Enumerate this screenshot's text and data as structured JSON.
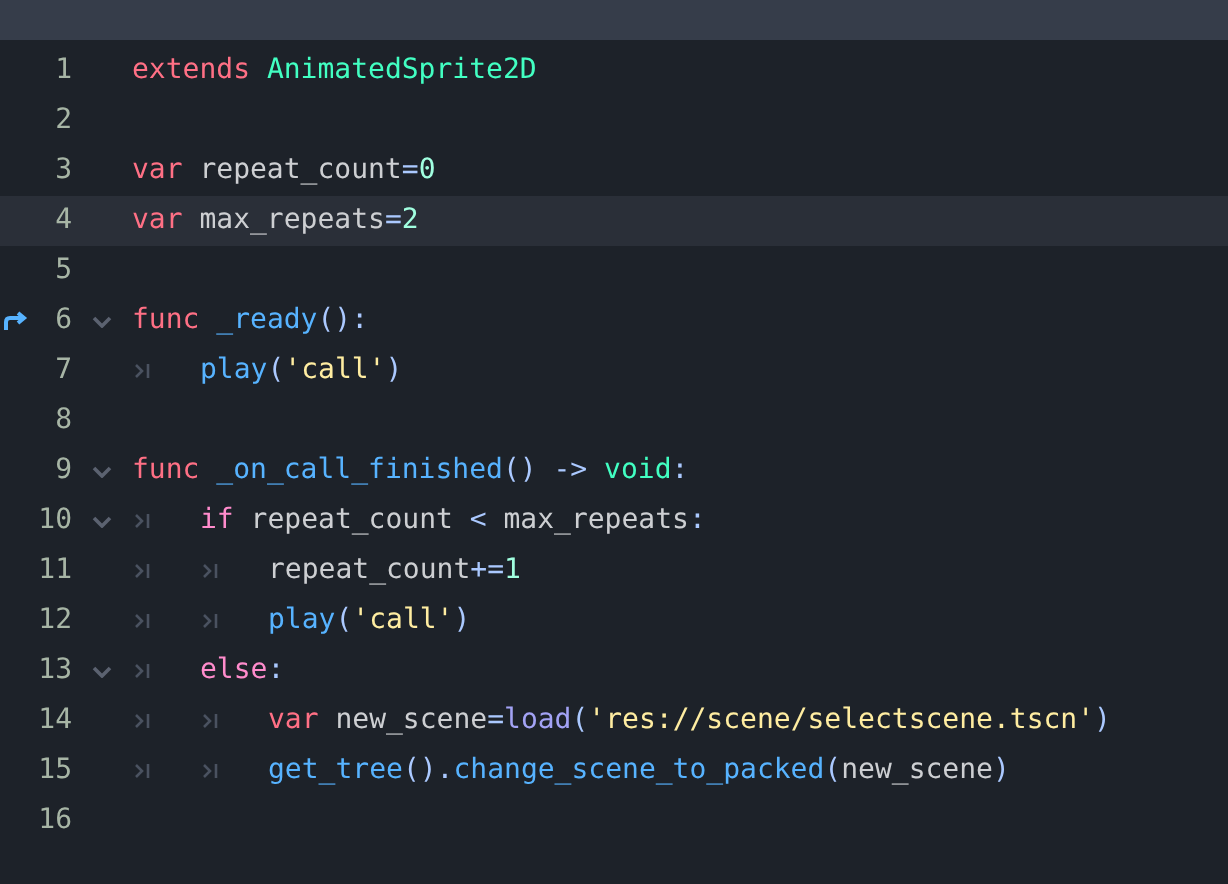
{
  "lines": [
    {
      "number": "1",
      "current": false,
      "foldable": false,
      "override": false,
      "tokens": [
        {
          "kind": "keyword",
          "text": "extends "
        },
        {
          "kind": "class",
          "text": "AnimatedSprite2D"
        }
      ]
    },
    {
      "number": "2",
      "current": false,
      "foldable": false,
      "override": false
    },
    {
      "number": "3",
      "current": false,
      "foldable": false,
      "override": false,
      "tokens": [
        {
          "kind": "keyword",
          "text": "var "
        },
        {
          "kind": "plain",
          "text": "repeat_count"
        },
        {
          "kind": "operator",
          "text": "="
        },
        {
          "kind": "number",
          "text": "0"
        }
      ]
    },
    {
      "number": "4",
      "current": true,
      "foldable": false,
      "override": false,
      "tokens": [
        {
          "kind": "keyword",
          "text": "var "
        },
        {
          "kind": "plain",
          "text": "max_repeats"
        },
        {
          "kind": "operator",
          "text": "="
        },
        {
          "kind": "number",
          "text": "2"
        }
      ]
    },
    {
      "number": "5",
      "current": false,
      "foldable": false,
      "override": false
    },
    {
      "number": "6",
      "current": false,
      "foldable": true,
      "override": true,
      "tokens": [
        {
          "kind": "keyword",
          "text": "func "
        },
        {
          "kind": "function",
          "text": "_ready"
        },
        {
          "kind": "operator",
          "text": "():"
        }
      ]
    },
    {
      "number": "7",
      "current": false,
      "foldable": false,
      "override": false,
      "tokens": [
        {
          "kind": "tab"
        },
        {
          "kind": "function",
          "text": "play"
        },
        {
          "kind": "operator",
          "text": "("
        },
        {
          "kind": "string",
          "text": "'call'"
        },
        {
          "kind": "operator",
          "text": ")"
        }
      ]
    },
    {
      "number": "8",
      "current": false,
      "foldable": false,
      "override": false
    },
    {
      "number": "9",
      "current": false,
      "foldable": true,
      "override": false,
      "tokens": [
        {
          "kind": "keyword",
          "text": "func "
        },
        {
          "kind": "function",
          "text": "_on_call_finished"
        },
        {
          "kind": "operator",
          "text": "() -> "
        },
        {
          "kind": "class",
          "text": "void"
        },
        {
          "kind": "operator",
          "text": ":"
        }
      ]
    },
    {
      "number": "10",
      "current": false,
      "foldable": true,
      "override": false,
      "tokens": [
        {
          "kind": "tab"
        },
        {
          "kind": "control",
          "text": "if "
        },
        {
          "kind": "plain",
          "text": "repeat_count "
        },
        {
          "kind": "operator",
          "text": "< "
        },
        {
          "kind": "plain",
          "text": "max_repeats"
        },
        {
          "kind": "operator",
          "text": ":"
        }
      ]
    },
    {
      "number": "11",
      "current": false,
      "foldable": false,
      "override": false,
      "tokens": [
        {
          "kind": "tab"
        },
        {
          "kind": "tab"
        },
        {
          "kind": "plain",
          "text": "repeat_count"
        },
        {
          "kind": "operator",
          "text": "+="
        },
        {
          "kind": "number",
          "text": "1"
        }
      ]
    },
    {
      "number": "12",
      "current": false,
      "foldable": false,
      "override": false,
      "tokens": [
        {
          "kind": "tab"
        },
        {
          "kind": "tab"
        },
        {
          "kind": "function",
          "text": "play"
        },
        {
          "kind": "operator",
          "text": "("
        },
        {
          "kind": "string",
          "text": "'call'"
        },
        {
          "kind": "operator",
          "text": ")"
        }
      ]
    },
    {
      "number": "13",
      "current": false,
      "foldable": true,
      "override": false,
      "tokens": [
        {
          "kind": "tab"
        },
        {
          "kind": "control",
          "text": "else"
        },
        {
          "kind": "operator",
          "text": ":"
        }
      ]
    },
    {
      "number": "14",
      "current": false,
      "foldable": false,
      "override": false,
      "tokens": [
        {
          "kind": "tab"
        },
        {
          "kind": "tab"
        },
        {
          "kind": "keyword",
          "text": "var "
        },
        {
          "kind": "plain",
          "text": "new_scene"
        },
        {
          "kind": "operator",
          "text": "="
        },
        {
          "kind": "builtin",
          "text": "load"
        },
        {
          "kind": "operator",
          "text": "("
        },
        {
          "kind": "string",
          "text": "'res://scene/selectscene.tscn'"
        },
        {
          "kind": "operator",
          "text": ")"
        }
      ]
    },
    {
      "number": "15",
      "current": false,
      "foldable": false,
      "override": false,
      "tokens": [
        {
          "kind": "tab"
        },
        {
          "kind": "tab"
        },
        {
          "kind": "function",
          "text": "get_tree"
        },
        {
          "kind": "operator",
          "text": "()."
        },
        {
          "kind": "function",
          "text": "change_scene_to_packed"
        },
        {
          "kind": "operator",
          "text": "("
        },
        {
          "kind": "plain",
          "text": "new_scene"
        },
        {
          "kind": "operator",
          "text": ")"
        }
      ]
    },
    {
      "number": "16",
      "current": false,
      "foldable": false,
      "override": false
    }
  ]
}
